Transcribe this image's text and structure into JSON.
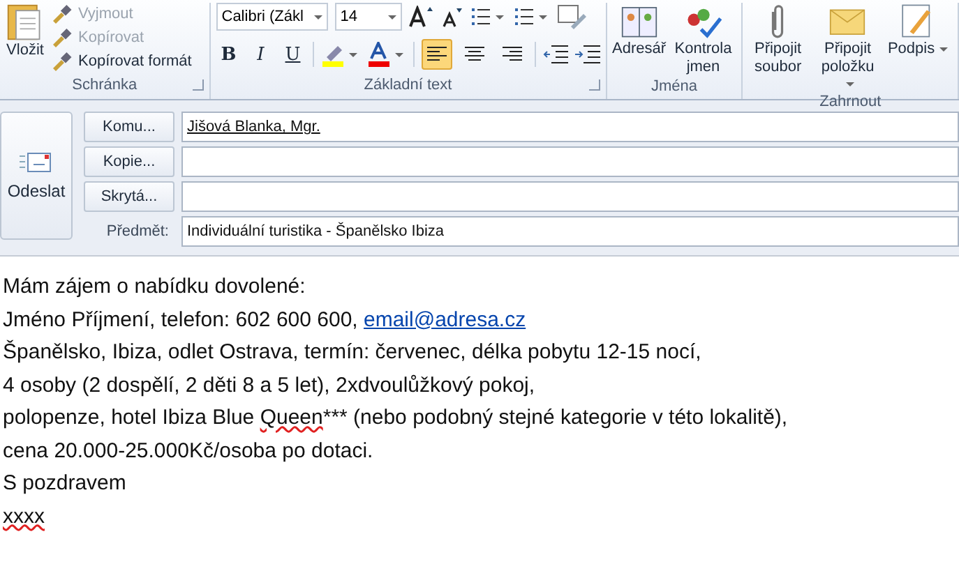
{
  "ribbon": {
    "clipboard": {
      "paste": "Vložit",
      "items": [
        {
          "label": "Vyjmout",
          "disabled": true
        },
        {
          "label": "Kopírovat",
          "disabled": true
        },
        {
          "label": "Kopírovat formát",
          "disabled": false
        }
      ],
      "group_label": "Schránka"
    },
    "basic_text": {
      "font": "Calibri (Zákl",
      "size": "14",
      "format_buttons": [
        "B",
        "I",
        "U"
      ],
      "align": [
        {
          "selected": true
        },
        {
          "selected": false
        },
        {
          "selected": false
        }
      ],
      "group_label": "Základní text"
    },
    "names": {
      "buttons": [
        {
          "label": "Adresář"
        },
        {
          "label": "Kontrola jmen"
        }
      ],
      "group_label": "Jména"
    },
    "include": {
      "buttons": [
        {
          "label": "Připojit soubor",
          "dropdown": false
        },
        {
          "label": "Připojit položku",
          "dropdown": true
        },
        {
          "label": "Podpis",
          "dropdown": true
        }
      ],
      "group_label": "Zahrnout"
    }
  },
  "header": {
    "send": "Odeslat",
    "fields": [
      {
        "button": "Komu...",
        "value": "Jišová Blanka, Mgr."
      },
      {
        "button": "Kopie..."
      },
      {
        "button": "Skrytá..."
      }
    ],
    "subject_label": "Předmět:",
    "subject": "Individuální turistika - Španělsko Ibiza"
  },
  "body": {
    "lines": [
      [
        {
          "kind": "plain",
          "text": "Mám zájem o nabídku dovolené:"
        }
      ],
      [
        {
          "kind": "plain",
          "text": "Jméno Příjmení, telefon: 602 600 600, "
        },
        {
          "kind": "link",
          "text": "email@adresa.cz"
        }
      ],
      [
        {
          "kind": "plain",
          "text": "Španělsko, Ibiza, odlet Ostrava, termín: červenec, délka pobytu 12-15 nocí,"
        }
      ],
      [
        {
          "kind": "plain",
          "text": "4 osoby (2 dospělí, 2 děti 8 a 5 let), 2xdvoulůžkový pokoj,"
        }
      ],
      [
        {
          "kind": "plain",
          "text": "polopenze, hotel Ibiza Blue "
        },
        {
          "kind": "misspelled",
          "text": "Queen"
        },
        {
          "kind": "plain",
          "text": "*** (nebo podobný stejné kategorie v této lokalitě),"
        }
      ],
      [
        {
          "kind": "plain",
          "text": "cena 20.000-25.000Kč/osoba po dotaci."
        }
      ],
      [
        {
          "kind": "plain",
          "text": "S pozdravem"
        }
      ],
      [
        {
          "kind": "misspelled",
          "text": "xxxx"
        }
      ]
    ]
  }
}
